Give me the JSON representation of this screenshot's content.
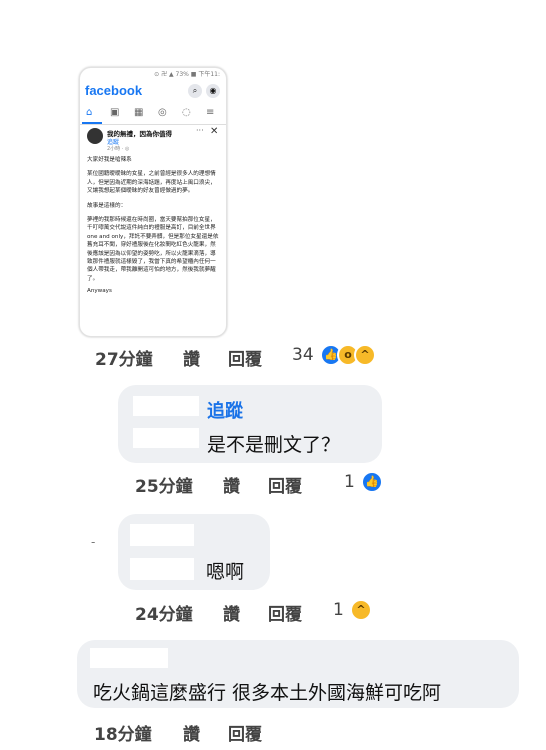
{
  "post_screenshot": {
    "status_text": "⊙ 卍 ▲ 73% ■ 下午11:",
    "app_name": "facebook",
    "search_glyph": "⌕",
    "messenger_glyph": "◉",
    "nav_icons": [
      "home-icon",
      "video-icon",
      "marketplace-icon",
      "groups-icon",
      "notifications-icon",
      "menu-icon"
    ],
    "nav_glyphs": [
      "⌂",
      "▣",
      "▦",
      "◎",
      "◌",
      "≡"
    ],
    "title": "我的無禮，因為你值得",
    "more_glyph": "···",
    "close_glyph": "✕",
    "author": "追蹤",
    "time": "2小時 · ◎",
    "paragraphs": [
      "大家好我是嗆辣系",
      "某位國籍曖曖昧的女星，之前曾經是很多人的理想情人，但是因為近期的深海話題，再度站上風口浪尖，又讓我想起某個曖昧的好友曾經做過的夢。",
      "故事是這樣的：",
      "夢裡的我那時候還在時尚圈，當天要幫拍那位女星，千叮嚀萬交代說這件純白的禮服是高訂，目前全世界one and only，拜託不要弄髒，但是那位女星還是依舊充耳不聞，穿好禮服後在化妝間吃紅色火龍果，然後應該是因為以仰望的姿勢吃，所以火龍果滴落，導致那件禮服就這樣毀了，我當下真的希望櫃內任何一個人帶我走，帶我離開這可怕的地方，然後我就夢醒了。"
    ],
    "closing": "Anyways"
  },
  "comments": [
    {
      "time": "27分鐘",
      "like": "讚",
      "reply": "回覆",
      "count": "34",
      "reacts": [
        "like",
        "wow",
        "haha"
      ],
      "react_glyphs": [
        "👍",
        "o",
        "^"
      ]
    },
    {
      "author": "追蹤",
      "text": "是不是刪文了？",
      "time": "25分鐘",
      "like": "讚",
      "reply": "回覆",
      "count": "1",
      "reacts": [
        "like"
      ],
      "react_glyphs": [
        "👍"
      ]
    },
    {
      "marker": "-",
      "text": "嗯啊",
      "time": "24分鐘",
      "like": "讚",
      "reply": "回覆",
      "count": "1",
      "reacts": [
        "haha"
      ],
      "react_glyphs": [
        "^"
      ]
    },
    {
      "text": "吃火鍋這麼盛行 很多本土外國海鮮可吃阿",
      "time": "18分鐘",
      "like": "讚",
      "reply": "回覆"
    }
  ],
  "colors": {
    "facebook_blue": "#1877f2",
    "bubble": "#eef0f3",
    "author_blue": "#1a73e8",
    "react_yellow": "#f7b928"
  }
}
